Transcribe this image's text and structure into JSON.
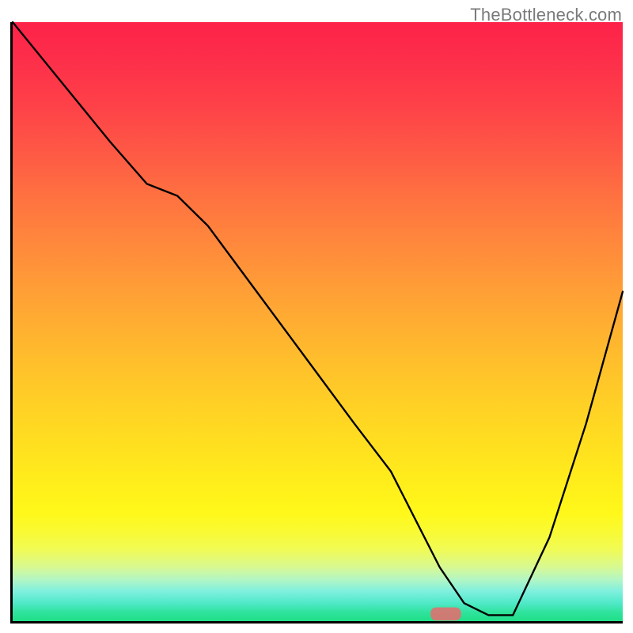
{
  "watermark": "TheBottleneck.com",
  "chart_data": {
    "type": "line",
    "title": "",
    "xlabel": "",
    "ylabel": "",
    "x_range": [
      0,
      100
    ],
    "y_range": [
      0,
      100
    ],
    "grid": false,
    "legend": null,
    "background": "rainbow-gradient-vertical",
    "gradient_stops": [
      {
        "pos": 0,
        "color": "#fd2249"
      },
      {
        "pos": 0.3,
        "color": "#ff7440"
      },
      {
        "pos": 0.62,
        "color": "#ffcc27"
      },
      {
        "pos": 0.82,
        "color": "#fff81a"
      },
      {
        "pos": 0.93,
        "color": "#b4f6c3"
      },
      {
        "pos": 1.0,
        "color": "#1fdf88"
      }
    ],
    "series": [
      {
        "name": "bottleneck-curve",
        "color": "#000000",
        "stroke_width": 2,
        "x": [
          0,
          8,
          16,
          22,
          27,
          32,
          40,
          48,
          56,
          62,
          66,
          70,
          74,
          78,
          82,
          88,
          94,
          100
        ],
        "y": [
          100,
          90,
          80,
          73,
          71,
          66,
          55,
          44,
          33,
          25,
          17,
          9,
          3,
          1,
          1,
          14,
          33,
          55
        ]
      }
    ],
    "marker": {
      "name": "optimal-point",
      "shape": "pill",
      "color": "#e07070",
      "x_center": 71,
      "y_center": 1.2,
      "width_x_units": 5,
      "height_y_units": 2.2
    },
    "notes": "V-shaped black curve over a vertical red→orange→yellow→green gradient. No axis ticks or numeric labels are visible. y values are read as percentage of plot height from bottom; x as percentage of plot width from left. Curve minimum (~y≈1) is near x≈74–80; a small salmon pill marks the minimum."
  }
}
